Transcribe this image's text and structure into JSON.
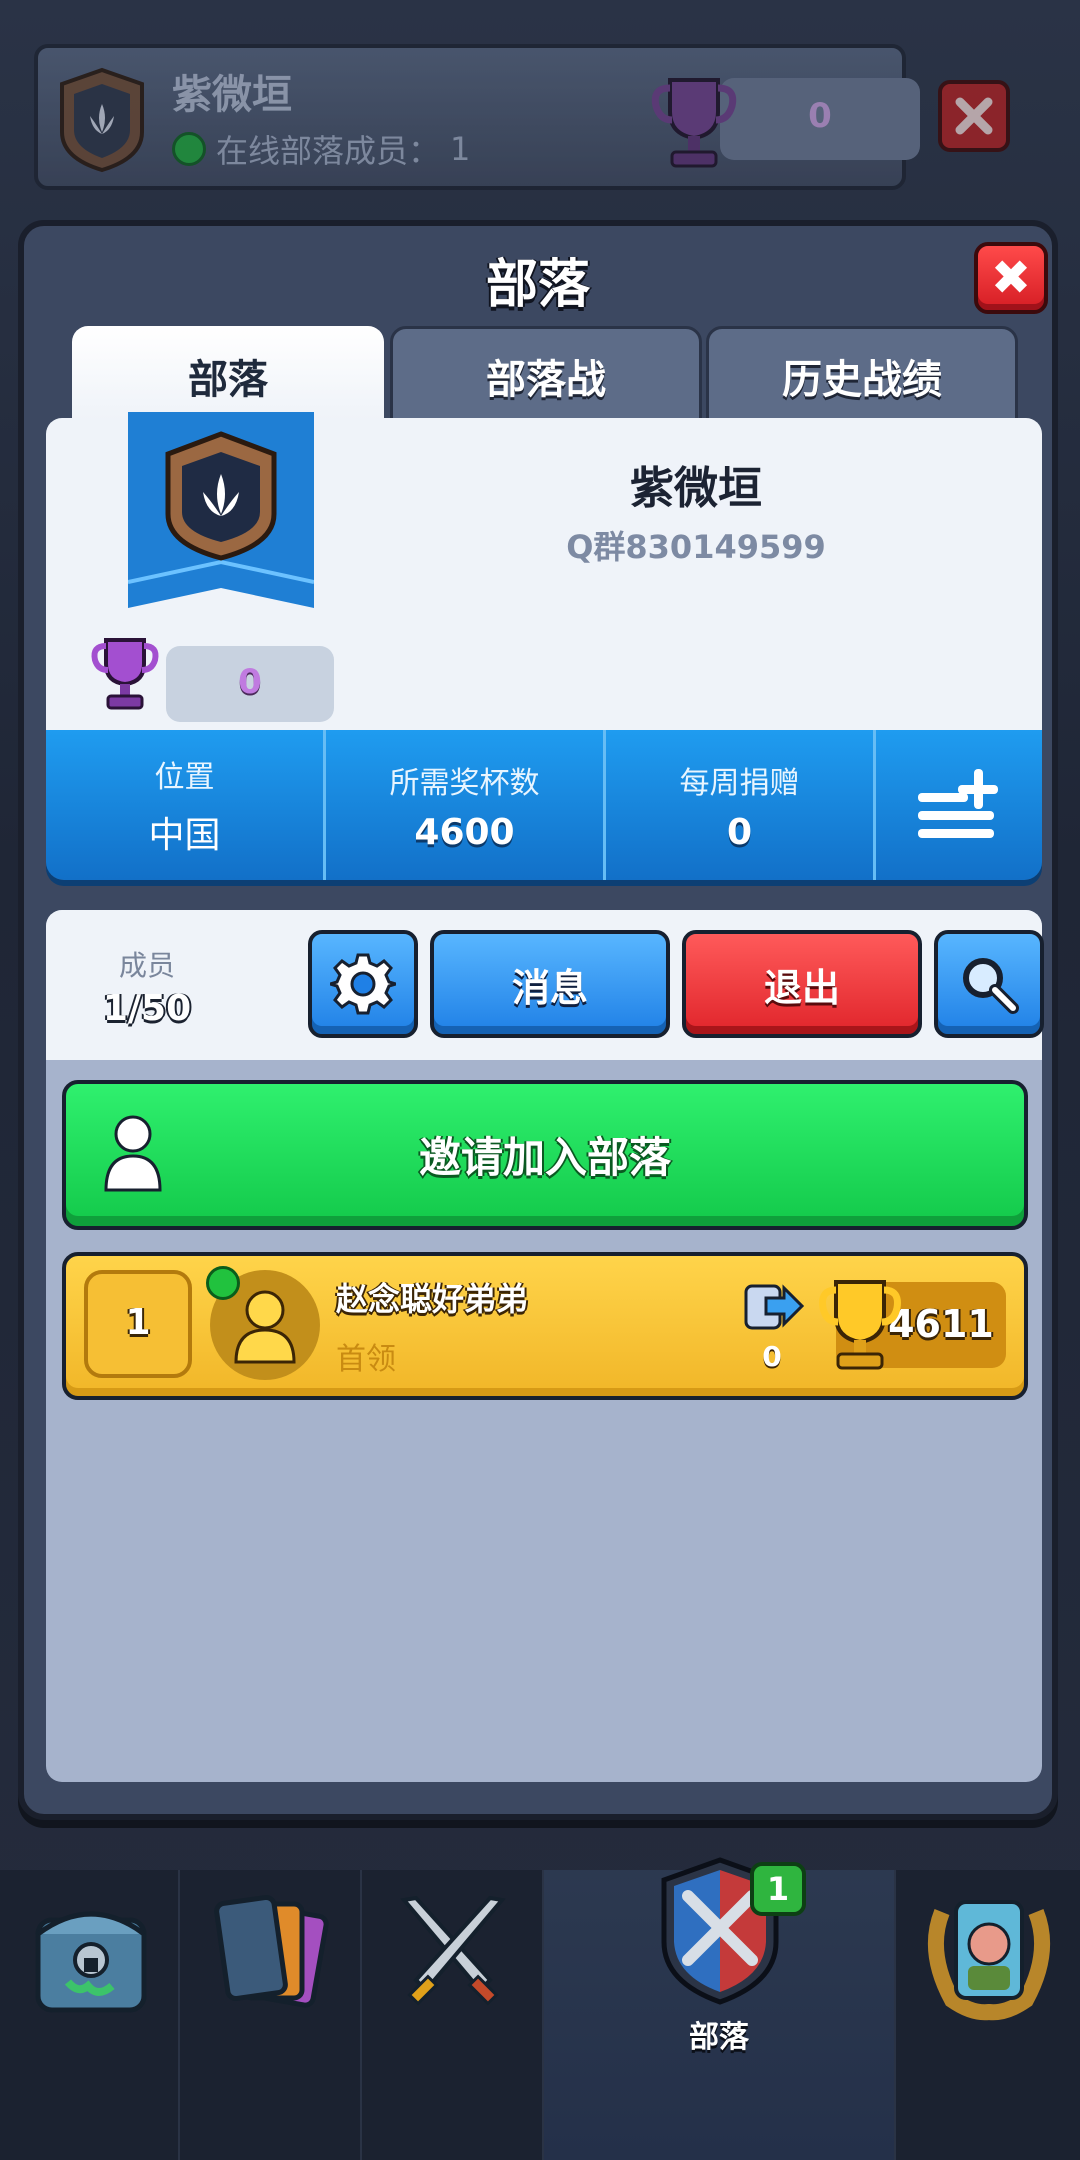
{
  "top_bar": {
    "clan_name": "紫微垣",
    "online_label": "在线部落成员：",
    "online_count": "1",
    "trophies": "0"
  },
  "panel": {
    "title": "部落",
    "close": "✖",
    "tabs": [
      {
        "label": "部落",
        "active": true
      },
      {
        "label": "部落战",
        "active": false
      },
      {
        "label": "历史战绩",
        "active": false
      }
    ]
  },
  "clan": {
    "name": "紫微垣",
    "description": "Q群830149599",
    "trophies": "0",
    "stats": [
      {
        "label": "位置",
        "value": "中国"
      },
      {
        "label": "所需奖杯数",
        "value": "4600"
      },
      {
        "label": "每周捐赠",
        "value": "0"
      }
    ]
  },
  "members": {
    "label": "成员",
    "count": "1/50",
    "message_button": "消息",
    "exit_button": "退出",
    "invite_button": "邀请加入部落",
    "list": [
      {
        "rank": "1",
        "name": "赵念聪好弟弟",
        "role": "首领",
        "donations": "0",
        "trophies": "4611",
        "online": true
      }
    ]
  },
  "nav": {
    "items": [
      "shop",
      "cards",
      "battle",
      "clan",
      "events"
    ],
    "active_label": "部落",
    "active_badge": "1"
  },
  "colors": {
    "accent_blue": "#1f80e6",
    "exit_red": "#e0252b",
    "invite_green": "#13c94a",
    "leader_gold": "#f1b628"
  }
}
